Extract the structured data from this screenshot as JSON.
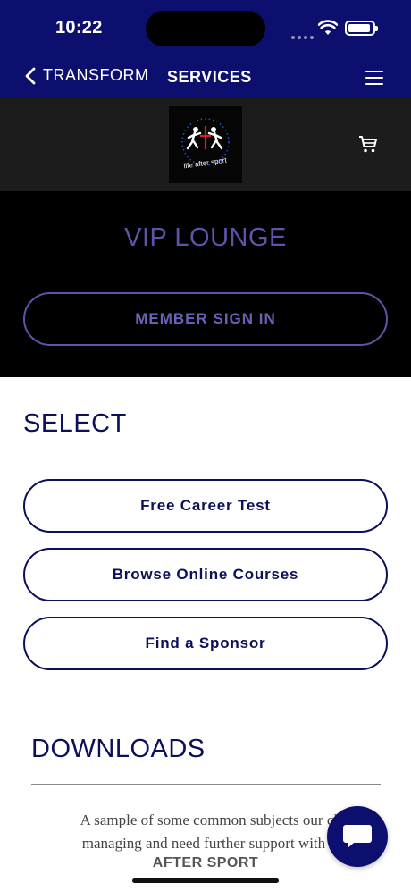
{
  "status_bar": {
    "time": "10:22"
  },
  "nav": {
    "back_label": "TRANSFORM",
    "title": "SERVICES"
  },
  "header": {
    "logo_text": "life after sport"
  },
  "vip": {
    "title": "VIP LOUNGE",
    "signin_label": "MEMBER SIGN IN"
  },
  "select": {
    "title": "SELECT",
    "options": [
      {
        "label": "Free Career Test"
      },
      {
        "label": "Browse Online Courses"
      },
      {
        "label": "Find a Sponsor"
      }
    ]
  },
  "downloads": {
    "title": "DOWNLOADS",
    "text_line1": "A sample of some common subjects our clie",
    "text_line2": "managing and need further support with fro",
    "subheading": "AFTER SPORT"
  },
  "colors": {
    "navy": "#0c0f6e",
    "text_navy": "#0c0f5a",
    "purple": "#5d54a8"
  },
  "icons": {
    "back": "chevron-left-icon",
    "menu": "hamburger-menu-icon",
    "cart": "shopping-cart-icon",
    "chat": "chat-bubble-icon"
  }
}
